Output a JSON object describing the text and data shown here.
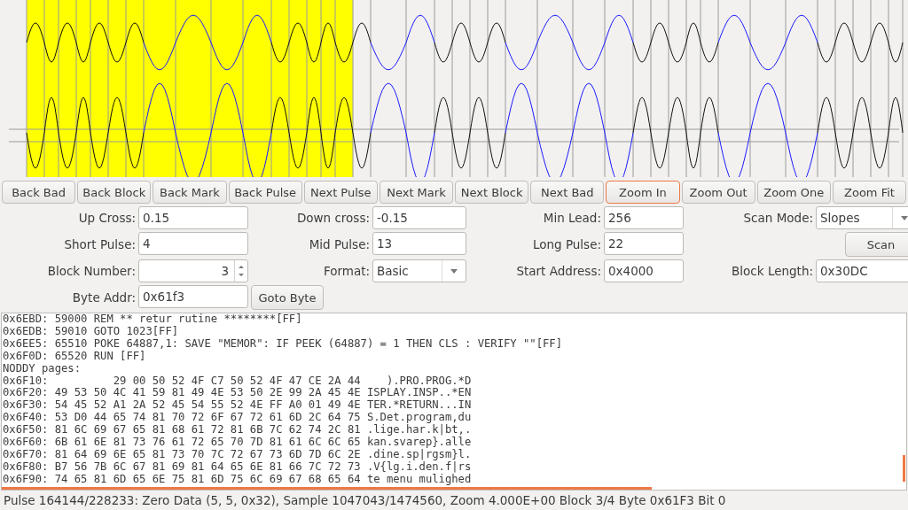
{
  "buttons": [
    {
      "label": "Back Bad",
      "focused": false
    },
    {
      "label": "Back Block",
      "focused": false
    },
    {
      "label": "Back Mark",
      "focused": false
    },
    {
      "label": "Back Pulse",
      "focused": false
    },
    {
      "label": "Next Pulse",
      "focused": false
    },
    {
      "label": "Next Mark",
      "focused": false
    },
    {
      "label": "Next Block",
      "focused": false
    },
    {
      "label": "Next Bad",
      "focused": false
    },
    {
      "label": "Zoom In",
      "focused": true
    },
    {
      "label": "Zoom Out",
      "focused": false
    },
    {
      "label": "Zoom One",
      "focused": false
    },
    {
      "label": "Zoom Fit",
      "focused": false
    }
  ],
  "form_rows": [
    [
      {
        "kind": "field",
        "label": "Up Cross:",
        "value": "0.15"
      },
      {
        "kind": "field",
        "label": "Down cross:",
        "value": "-0.15"
      },
      {
        "kind": "field",
        "label": "Min Lead:",
        "value": "256"
      },
      {
        "kind": "dropdown",
        "label": "Scan Mode:",
        "value": "Slopes"
      }
    ],
    [
      {
        "kind": "field",
        "label": "Short Pulse:",
        "value": "4"
      },
      {
        "kind": "field",
        "label": "Mid Pulse:",
        "value": "13"
      },
      {
        "kind": "field",
        "label": "Long Pulse:",
        "value": "22"
      },
      {
        "kind": "button",
        "label": "Scan"
      }
    ],
    [
      {
        "kind": "spin",
        "label": "Block Number:",
        "value": "3"
      },
      {
        "kind": "dropdown",
        "label": "Format:",
        "value": "Basic"
      },
      {
        "kind": "field",
        "label": "Start Address:",
        "value": "0x4000"
      },
      {
        "kind": "field",
        "label": "Block Length:",
        "value": "0x30DC"
      }
    ],
    [
      {
        "kind": "field",
        "label": "Byte Addr:",
        "value": "0x61f3"
      },
      {
        "kind": "button",
        "label": "Goto Byte"
      }
    ]
  ],
  "listing": [
    "0x6EBD: 59000 REM ** retur rutine ********[FF]",
    "0x6EDB: 59010 GOTO 1023[FF]",
    "0x6EE5: 65510 POKE 64887,1: SAVE \"MEMOR\": IF PEEK (64887) = 1 THEN CLS : VERIFY \"\"[FF]",
    "0x6F0D: 65520 RUN [FF]",
    "NODDY pages:",
    "0x6F10:          29 00 50 52 4F C7 50 52 4F 47 CE 2A 44    ).PRO.PROG.*D",
    "0x6F20: 49 53 50 4C 41 59 81 49 4E 53 50 2E 99 2A 45 4E ISPLAY.INSP..*EN",
    "0x6F30: 54 45 52 A1 2A 52 45 54 55 52 4E FF A0 01 49 4E TER.*RETURN...IN",
    "0x6F40: 53 D0 44 65 74 81 70 72 6F 67 72 61 6D 2C 64 75 S.Det.program,du",
    "0x6F50: 81 6C 69 67 65 81 68 61 72 81 6B 7C 62 74 2C 81 .lige.har.k|bt,.",
    "0x6F60: 6B 61 6E 81 73 76 61 72 65 70 7D 81 61 6C 6C 65 kan.svarep}.alle",
    "0x6F70: 81 64 69 6E 65 81 73 70 7C 72 67 73 6D 7D 6C 2E .dine.sp|rgsm}l.",
    "0x6F80: B7 56 7B 6C 67 81 69 81 64 65 6E 81 66 7C 72 73 .V{lg.i.den.f|rs",
    "0x6F90: 74 65 81 6D 65 6E 75 81 6D 75 6C 69 67 68 65 64 te menu mulighed"
  ],
  "status_bar": "Pulse 164144/228233: Zero Data (5, 5, 0x32), Sample 1047043/1474560, Zoom  4.000E+00 Block 3/4 Byte 0x61F3 Bit 0"
}
